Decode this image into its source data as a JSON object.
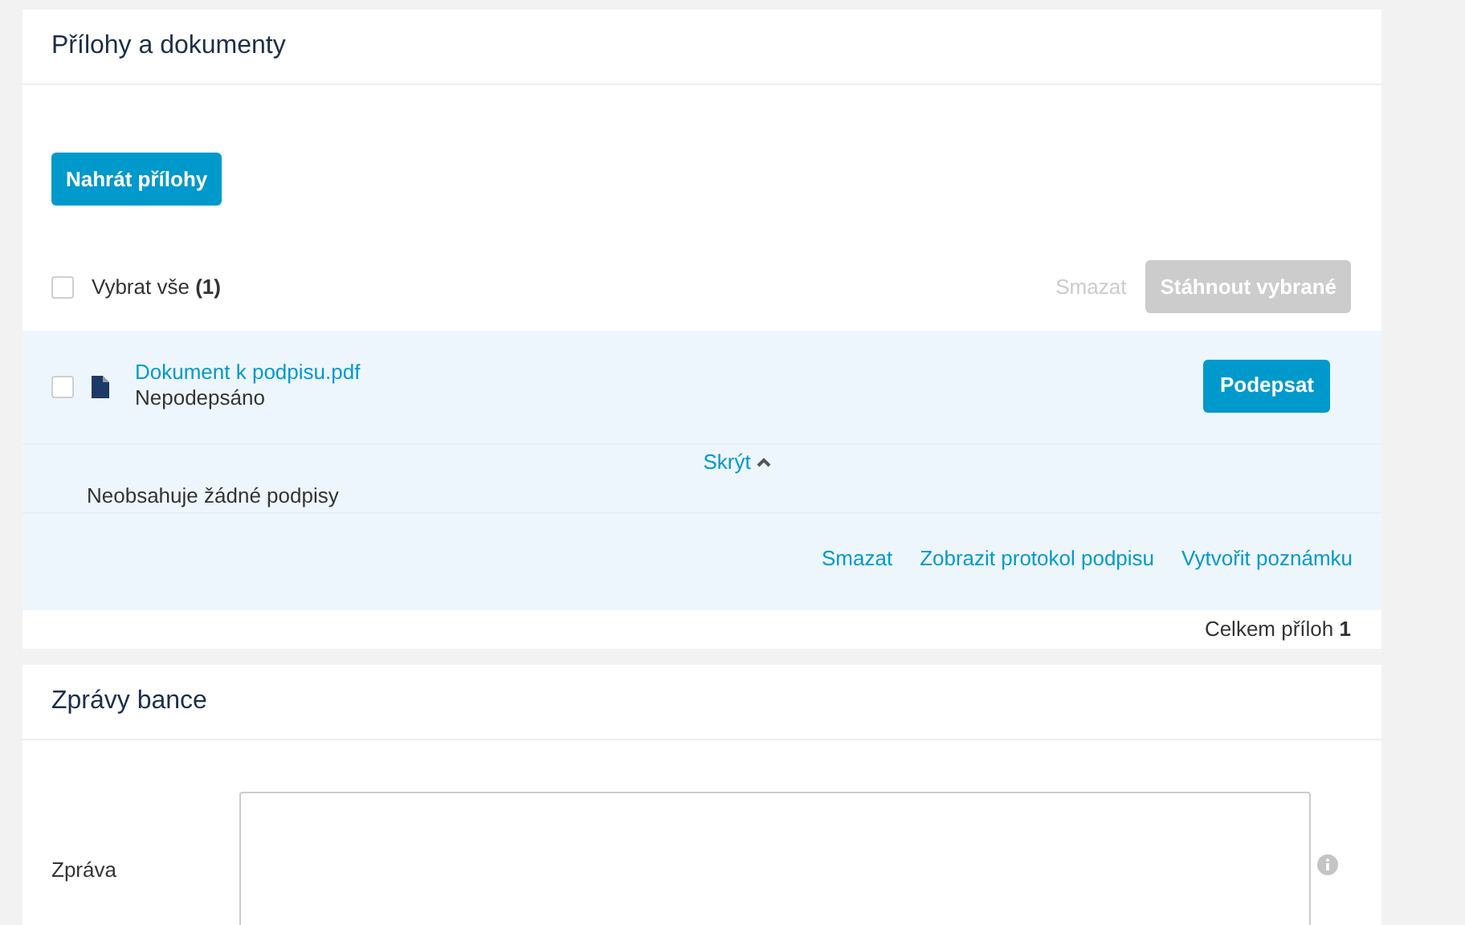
{
  "attachments": {
    "title": "Přílohy a dokumenty",
    "upload_button": "Nahrát přílohy",
    "select_all": {
      "label": "Vybrat vše",
      "count": "(1)",
      "checked": false
    },
    "bulk_actions": [
      {
        "kind": "link",
        "label": "Smazat",
        "disabled": true
      },
      {
        "kind": "button",
        "label": "Stáhnout vybrané",
        "disabled": true
      }
    ],
    "files": [
      {
        "name": "Dokument k podpisu.pdf",
        "status": "Nepodepsáno",
        "checked": false,
        "sign_button": "Podepsat",
        "expanded": true,
        "toggle": "Skrýt",
        "details": "Neobsahuje žádné podpisy",
        "actions": [
          "Smazat",
          "Zobrazit protokol podpisu",
          "Vytvořit poznámku"
        ]
      }
    ],
    "total_label": "Celkem příloh",
    "total": "1"
  },
  "bank_messages": {
    "title": "Zprávy bance",
    "field_label": "Zpráva"
  }
}
